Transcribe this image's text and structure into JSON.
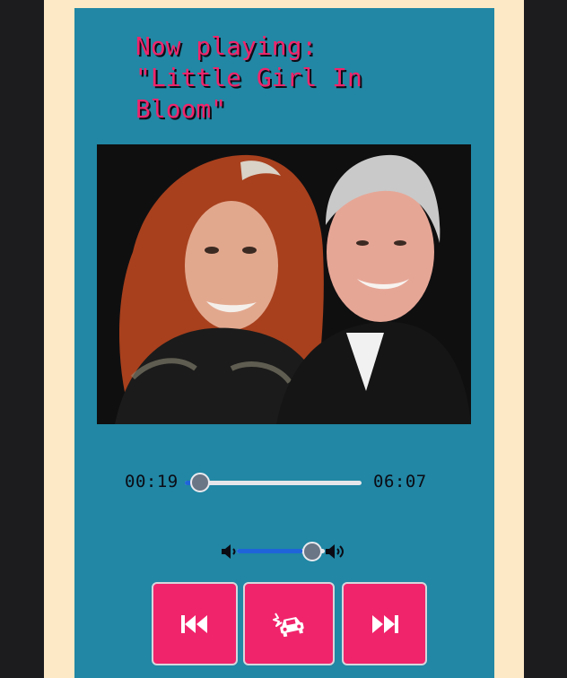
{
  "player": {
    "title": "Now playing:\n\"Little Girl In\nBloom\"",
    "album_art": {
      "subject": "photo of two smiling people"
    },
    "progress": {
      "current_time": "00:19",
      "duration": "06:07",
      "fraction": 0.052
    },
    "volume": {
      "level": 0.75
    },
    "controls": {
      "previous_icon": "skip-back-icon",
      "middle_icon": "car-crash-icon",
      "next_icon": "skip-forward-icon"
    },
    "colors": {
      "frame": "#fde9c5",
      "panel": "#2187a4",
      "accent": "#f0246b",
      "slider_fill": "#1f64d8"
    }
  }
}
